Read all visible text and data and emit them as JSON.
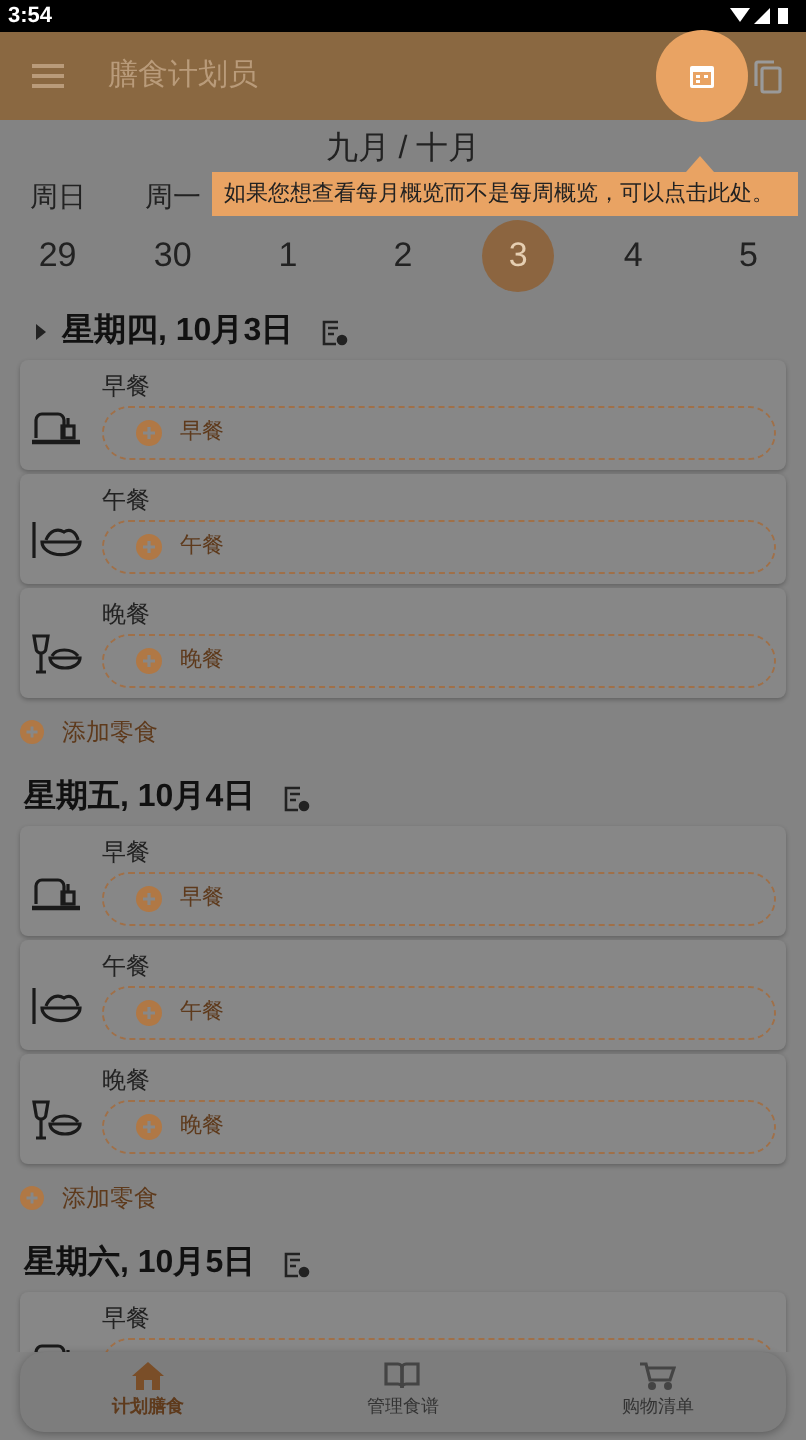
{
  "status_bar": {
    "time": "3:54"
  },
  "app_bar": {
    "title": "膳食计划员"
  },
  "tooltip": {
    "text": "如果您想查看每月概览而不是每周概览，可以点击此处。"
  },
  "calendar": {
    "month": "九月 / 十月",
    "weekdays": [
      "周日",
      "周一"
    ],
    "dates": [
      {
        "label": "29",
        "selected": false
      },
      {
        "label": "30",
        "selected": false
      },
      {
        "label": "1",
        "selected": false
      },
      {
        "label": "2",
        "selected": false
      },
      {
        "label": "3",
        "selected": true
      },
      {
        "label": "4",
        "selected": false
      },
      {
        "label": "5",
        "selected": false
      }
    ]
  },
  "days": [
    {
      "title": "星期四, 10月3日",
      "caret": true,
      "meals": [
        {
          "kind": "breakfast",
          "label": "早餐",
          "placeholder": "早餐"
        },
        {
          "kind": "lunch",
          "label": "午餐",
          "placeholder": "午餐"
        },
        {
          "kind": "dinner",
          "label": "晚餐",
          "placeholder": "晚餐"
        }
      ],
      "add_snack": "添加零食"
    },
    {
      "title": "星期五, 10月4日",
      "caret": false,
      "meals": [
        {
          "kind": "breakfast",
          "label": "早餐",
          "placeholder": "早餐"
        },
        {
          "kind": "lunch",
          "label": "午餐",
          "placeholder": "午餐"
        },
        {
          "kind": "dinner",
          "label": "晚餐",
          "placeholder": "晚餐"
        }
      ],
      "add_snack": "添加零食"
    },
    {
      "title": "星期六, 10月5日",
      "caret": false,
      "meals": [
        {
          "kind": "breakfast",
          "label": "早餐"
        }
      ]
    }
  ],
  "bottom_nav": [
    {
      "kind": "home",
      "label": "计划膳食",
      "selected": true
    },
    {
      "kind": "book",
      "label": "管理食谱",
      "selected": false
    },
    {
      "kind": "cart",
      "label": "购物清单",
      "selected": false
    }
  ]
}
